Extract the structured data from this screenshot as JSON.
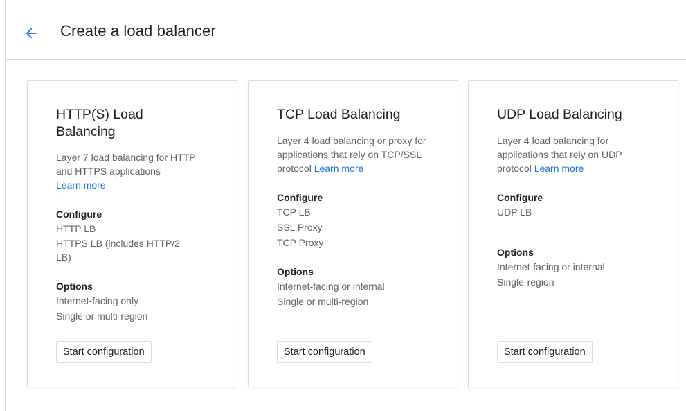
{
  "header": {
    "back_icon": "arrow-left-icon",
    "title": "Create a load balancer",
    "accent": "#1a73e8"
  },
  "cards": [
    {
      "title": "HTTP(S) Load Balancing",
      "description": "Layer 7 load balancing for HTTP and HTTPS applications",
      "learn_more": "Learn more",
      "configure_heading": "Configure",
      "configure_items": [
        "HTTP LB",
        "HTTPS LB (includes HTTP/2 LB)"
      ],
      "options_heading": "Options",
      "options_items": [
        "Internet-facing only",
        "Single or multi-region"
      ],
      "button": "Start configuration"
    },
    {
      "title": "TCP Load Balancing",
      "description": "Layer 4 load balancing or proxy for applications that rely on TCP/SSL protocol",
      "learn_more": "Learn more",
      "configure_heading": "Configure",
      "configure_items": [
        "TCP LB",
        "SSL Proxy",
        "TCP Proxy"
      ],
      "options_heading": "Options",
      "options_items": [
        "Internet-facing or internal",
        "Single or multi-region"
      ],
      "button": "Start configuration"
    },
    {
      "title": "UDP Load Balancing",
      "description": "Layer 4 load balancing for applications that rely on UDP protocol",
      "learn_more": "Learn more",
      "configure_heading": "Configure",
      "configure_items": [
        "UDP LB"
      ],
      "options_heading": "Options",
      "options_items": [
        "Internet-facing or internal",
        "Single-region"
      ],
      "button": "Start configuration"
    }
  ]
}
